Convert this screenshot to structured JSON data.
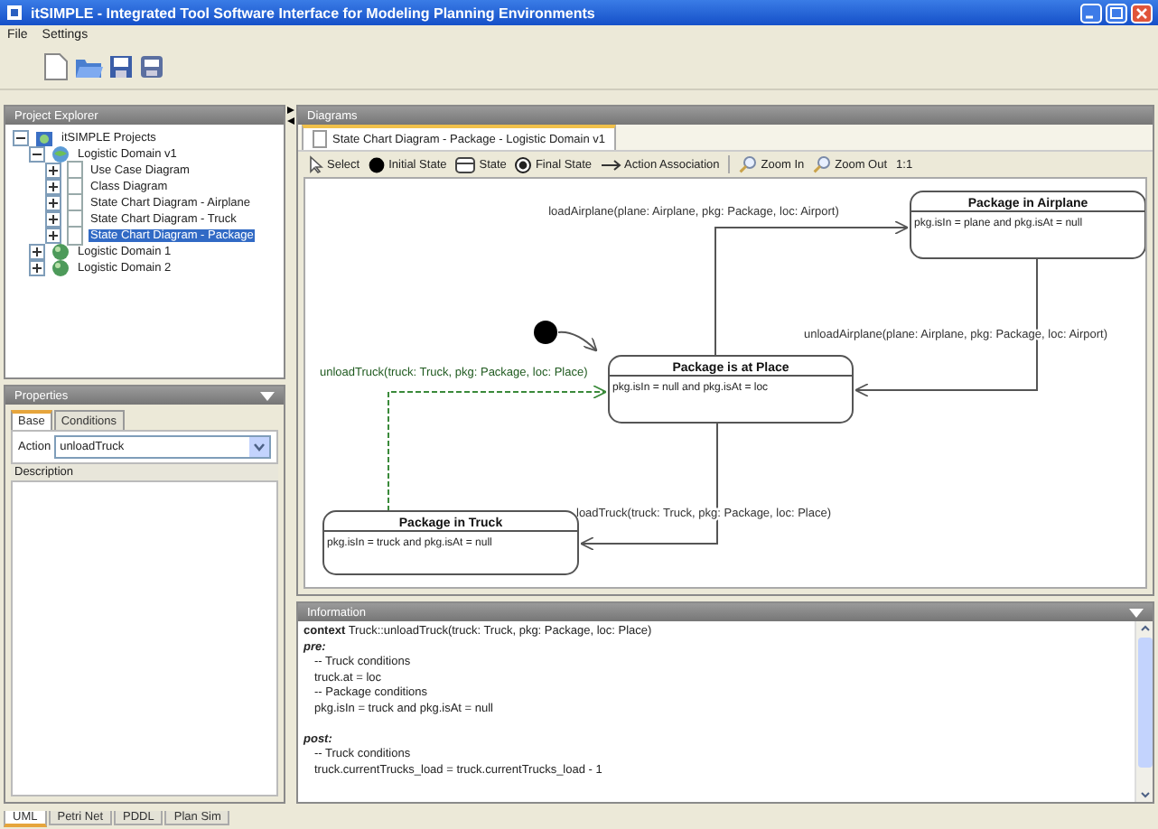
{
  "window": {
    "title": "itSIMPLE - Integrated Tool Software Interface for Modeling Planning Environments"
  },
  "menu": [
    "File",
    "Settings"
  ],
  "project_explorer": {
    "title": "Project Explorer",
    "tree": [
      {
        "label": "itSIMPLE Projects",
        "kind": "root",
        "expanded": true,
        "selected": false,
        "children": [
          {
            "label": "Logistic Domain v1",
            "kind": "project",
            "expanded": true,
            "selected": false,
            "children": [
              {
                "label": "Use Case Diagram",
                "kind": "diagram",
                "expanded": false,
                "selected": false
              },
              {
                "label": "Class Diagram",
                "kind": "diagram",
                "expanded": false,
                "selected": false
              },
              {
                "label": "State Chart Diagram - Airplane",
                "kind": "diagram",
                "expanded": false,
                "selected": false
              },
              {
                "label": "State Chart Diagram - Truck",
                "kind": "diagram",
                "expanded": false,
                "selected": false
              },
              {
                "label": "State Chart Diagram - Package",
                "kind": "diagram",
                "expanded": false,
                "selected": true
              }
            ]
          },
          {
            "label": "Logistic Domain 1",
            "kind": "domain",
            "expanded": false,
            "selected": false
          },
          {
            "label": "Logistic Domain 2",
            "kind": "domain",
            "expanded": false,
            "selected": false
          }
        ]
      }
    ]
  },
  "properties": {
    "title": "Properties",
    "tabs": [
      {
        "label": "Base",
        "selected": true
      },
      {
        "label": "Conditions",
        "selected": false
      }
    ],
    "action_label": "Action",
    "action_value": "unloadTruck",
    "description_label": "Description"
  },
  "bottom_tabs": [
    {
      "label": "UML",
      "selected": true
    },
    {
      "label": "Petri Net",
      "selected": false
    },
    {
      "label": "PDDL",
      "selected": false
    },
    {
      "label": "Plan Sim",
      "selected": false
    }
  ],
  "diagrams": {
    "title": "Diagrams",
    "tab": "State Chart Diagram - Package - Logistic Domain v1",
    "tools": [
      {
        "label": "Select",
        "kind": "select"
      },
      {
        "label": "Initial State",
        "kind": "initial"
      },
      {
        "label": "State",
        "kind": "state"
      },
      {
        "label": "Final State",
        "kind": "final"
      },
      {
        "label": "Action Association",
        "kind": "association"
      },
      {
        "label": "Zoom In",
        "kind": "zoom-in"
      },
      {
        "label": "Zoom Out",
        "kind": "zoom-out"
      },
      {
        "label": "1:1",
        "kind": "plain"
      }
    ],
    "states": [
      {
        "name": "Package in Airplane",
        "condition": "pkg.isIn = plane and pkg.isAt = null"
      },
      {
        "name": "Package is at Place",
        "condition": "pkg.isIn = null and pkg.isAt = loc"
      },
      {
        "name": "Package in Truck",
        "condition": "pkg.isIn = truck and pkg.isAt = null"
      }
    ],
    "transitions": [
      {
        "label": "loadAirplane(plane: Airplane, pkg: Package, loc: Airport)",
        "selected": false
      },
      {
        "label": "unloadAirplane(plane: Airplane, pkg: Package, loc: Airport)",
        "selected": false
      },
      {
        "label": "unloadTruck(truck: Truck, pkg: Package, loc: Place)",
        "selected": true
      },
      {
        "label": "loadTruck(truck: Truck, pkg: Package, loc: Place)",
        "selected": false
      }
    ]
  },
  "information": {
    "title": "Information",
    "lines": [
      {
        "text": "**context** Truck::unloadTruck(truck: Truck, pkg: Package, loc: Place)",
        "kind": "context"
      },
      {
        "text": "pre:",
        "kind": "keyword"
      },
      {
        "text": "-- Truck conditions",
        "kind": "code"
      },
      {
        "text": "truck.at = loc",
        "kind": "code"
      },
      {
        "text": "-- Package conditions",
        "kind": "code"
      },
      {
        "text": "pkg.isIn = truck and pkg.isAt = null",
        "kind": "code"
      },
      {
        "text": "post:",
        "kind": "keyword"
      },
      {
        "text": "-- Truck conditions",
        "kind": "code"
      },
      {
        "text": "truck.currentTrucks_load = truck.currentTrucks_load - 1",
        "kind": "code"
      }
    ]
  }
}
